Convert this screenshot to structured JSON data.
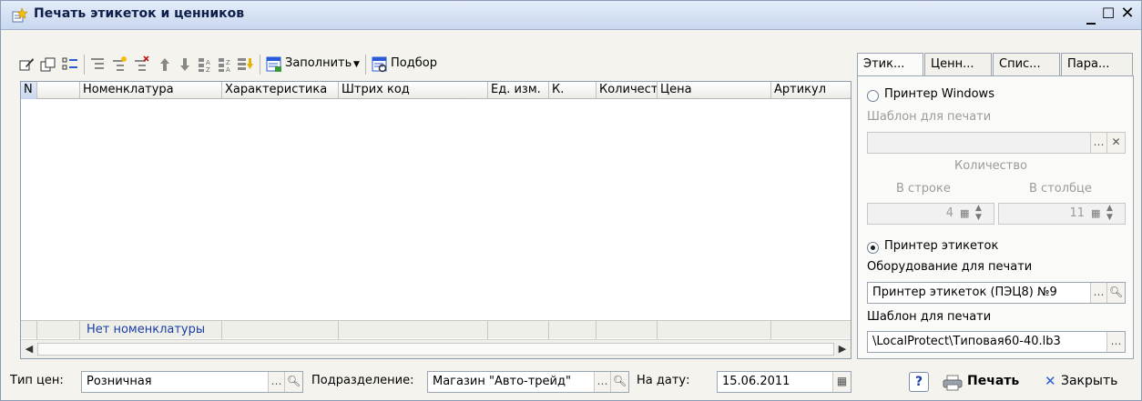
{
  "window": {
    "title": "Печать этикеток и ценников",
    "minimize": "_",
    "close": "☐ ✕"
  },
  "toolbar": {
    "fill_label": "Заполнить",
    "select_label": "Подбор"
  },
  "grid": {
    "columns": [
      "N",
      "",
      "Номенклатура",
      "Характеристика",
      "Штрих код",
      "Ед. изм.",
      "К.",
      "Количест...",
      "Цена",
      "Артикул"
    ],
    "footer_text": "Нет номенклатуры"
  },
  "tabs": [
    "Этик...",
    "Ценн...",
    "Спис...",
    "Пара..."
  ],
  "panel": {
    "radio_windows": "Принтер Windows",
    "template_label_1": "Шаблон для печати",
    "template_value_1": "",
    "quantity_label": "Количество",
    "in_row_label": "В строке",
    "in_col_label": "В столбце",
    "in_row_value": "4",
    "in_col_value": "11",
    "radio_label_printer": "Принтер этикеток",
    "equipment_label": "Оборудование для печати",
    "equipment_value": "Принтер этикеток (ПЭЦ8) №9",
    "template_label_2": "Шаблон для печати",
    "template_value_2": "\\LocalProtect\\Типовая60-40.lb3"
  },
  "bottom": {
    "price_type_label": "Тип цен:",
    "price_type_value": "Розничная",
    "department_label": "Подразделение:",
    "department_value": "Магазин \"Авто-трейд\"",
    "date_label": "На дату:",
    "date_value": "15.06.2011",
    "help": "?",
    "print": "Печать",
    "close": "Закрыть"
  },
  "colors": {
    "title_bg": "#c9d8ef",
    "footer_text": "#1a3da6",
    "accent_blue": "#2a5bd7"
  }
}
